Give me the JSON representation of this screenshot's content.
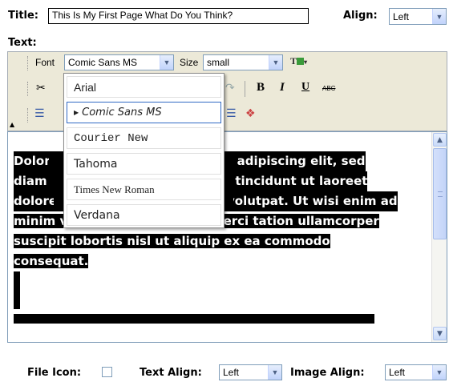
{
  "title": {
    "label": "Title:",
    "value": "This Is My First Page What Do You Think?"
  },
  "align": {
    "label": "Align:",
    "value": "Left"
  },
  "text_label": "Text:",
  "toolbar": {
    "font_label": "Font",
    "font_value": "Comic Sans MS",
    "size_label": "Size",
    "size_value": "small",
    "bold": "B",
    "italic": "I",
    "underline": "U",
    "strike": "ABC"
  },
  "font_menu": {
    "items": [
      "Arial",
      "Comic Sans MS",
      "Courier New",
      "Tahoma",
      "Times New Roman",
      "Verdana"
    ],
    "selected": "Comic Sans MS"
  },
  "editor": {
    "lines": [
      "Dolor",
      "r adipiscing elit, sed",
      "diam n",
      "l tincidunt ut laoreet",
      "dolore",
      "volutpat. Ut wisi enim ad",
      "minim veniam, quis nostrud exerci tation ullamcorper",
      "suscipit lobortis nisl ut aliquip ex ea commodo",
      "consequat."
    ]
  },
  "bottom": {
    "file_icon_label": "File Icon:",
    "text_align_label": "Text Align:",
    "text_align_value": "Left",
    "image_align_label": "Image Align:",
    "image_align_value": "Left"
  },
  "colors": {
    "highlight": "#000000",
    "toolbar": "#ece9d8",
    "border": "#7f9db9",
    "selected_item": "#316ac5"
  }
}
